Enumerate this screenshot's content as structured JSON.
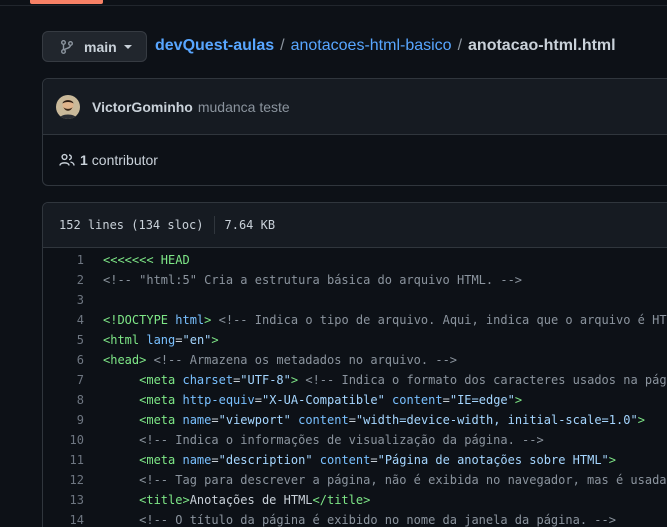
{
  "branch": {
    "label": "main"
  },
  "breadcrumb": {
    "repo": "devQuest-aulas",
    "folder": "anotacoes-html-basico",
    "file": "anotacao-html.html",
    "separator": "/"
  },
  "commit": {
    "author": "VictorGominho",
    "message": "mudanca teste",
    "contributors_count": "1",
    "contributors_label": "contributor"
  },
  "file_info": {
    "lines": "152 lines (134 sloc)",
    "size": "7.64 KB"
  },
  "colors": {
    "background": "#0d1117",
    "link": "#58a6ff",
    "tag": "#7ee787",
    "attribute": "#79c0ff",
    "string": "#a5d6ff",
    "comment": "#8b949e",
    "tab_accent": "#f78166"
  },
  "icons": {
    "branch": "git-branch-icon",
    "contributors": "people-icon",
    "caret": "caret-down-icon"
  },
  "code_lines": [
    {
      "num": "1",
      "tokens": [
        {
          "t": "<<<<<<< HEAD",
          "c": "git"
        }
      ]
    },
    {
      "num": "2",
      "tokens": [
        {
          "t": "<!-- \"html:5\" Cria a estrutura básica do arquivo HTML. -->",
          "c": "cm"
        }
      ]
    },
    {
      "num": "3",
      "tokens": []
    },
    {
      "num": "4",
      "tokens": [
        {
          "t": "<!DOCTYPE ",
          "c": "tag"
        },
        {
          "t": "html",
          "c": "attr"
        },
        {
          "t": ">",
          "c": "tag"
        },
        {
          "t": " ",
          "c": "pl"
        },
        {
          "t": "<!-- Indica o tipo de arquivo. Aqui, indica que o arquivo é HTML. -->",
          "c": "cm"
        }
      ]
    },
    {
      "num": "5",
      "tokens": [
        {
          "t": "<html ",
          "c": "tag"
        },
        {
          "t": "lang",
          "c": "attr"
        },
        {
          "t": "=",
          "c": "pl"
        },
        {
          "t": "\"en\"",
          "c": "str"
        },
        {
          "t": ">",
          "c": "tag"
        }
      ]
    },
    {
      "num": "6",
      "tokens": [
        {
          "t": "<head>",
          "c": "tag"
        },
        {
          "t": " ",
          "c": "pl"
        },
        {
          "t": "<!-- Armazena os metadados no arquivo. -->",
          "c": "cm"
        }
      ]
    },
    {
      "num": "7",
      "tokens": [
        {
          "t": "     ",
          "c": "pl"
        },
        {
          "t": "<meta ",
          "c": "tag"
        },
        {
          "t": "charset",
          "c": "attr"
        },
        {
          "t": "=",
          "c": "pl"
        },
        {
          "t": "\"UTF-8\"",
          "c": "str"
        },
        {
          "t": ">",
          "c": "tag"
        },
        {
          "t": " ",
          "c": "pl"
        },
        {
          "t": "<!-- Indica o formato dos caracteres usados na página. -->",
          "c": "cm"
        }
      ]
    },
    {
      "num": "8",
      "tokens": [
        {
          "t": "     ",
          "c": "pl"
        },
        {
          "t": "<meta ",
          "c": "tag"
        },
        {
          "t": "http-equiv",
          "c": "attr"
        },
        {
          "t": "=",
          "c": "pl"
        },
        {
          "t": "\"X-UA-Compatible\"",
          "c": "str"
        },
        {
          "t": " ",
          "c": "pl"
        },
        {
          "t": "content",
          "c": "attr"
        },
        {
          "t": "=",
          "c": "pl"
        },
        {
          "t": "\"IE=edge\"",
          "c": "str"
        },
        {
          "t": ">",
          "c": "tag"
        }
      ]
    },
    {
      "num": "9",
      "tokens": [
        {
          "t": "     ",
          "c": "pl"
        },
        {
          "t": "<meta ",
          "c": "tag"
        },
        {
          "t": "name",
          "c": "attr"
        },
        {
          "t": "=",
          "c": "pl"
        },
        {
          "t": "\"viewport\"",
          "c": "str"
        },
        {
          "t": " ",
          "c": "pl"
        },
        {
          "t": "content",
          "c": "attr"
        },
        {
          "t": "=",
          "c": "pl"
        },
        {
          "t": "\"width=device-width, initial-scale=1.0\"",
          "c": "str"
        },
        {
          "t": ">",
          "c": "tag"
        }
      ]
    },
    {
      "num": "10",
      "tokens": [
        {
          "t": "     ",
          "c": "pl"
        },
        {
          "t": "<!-- Indica o informações de visualização da página. -->",
          "c": "cm"
        }
      ]
    },
    {
      "num": "11",
      "tokens": [
        {
          "t": "     ",
          "c": "pl"
        },
        {
          "t": "<meta ",
          "c": "tag"
        },
        {
          "t": "name",
          "c": "attr"
        },
        {
          "t": "=",
          "c": "pl"
        },
        {
          "t": "\"description\"",
          "c": "str"
        },
        {
          "t": " ",
          "c": "pl"
        },
        {
          "t": "content",
          "c": "attr"
        },
        {
          "t": "=",
          "c": "pl"
        },
        {
          "t": "\"Página de anotações sobre HTML\"",
          "c": "str"
        },
        {
          "t": ">",
          "c": "tag"
        }
      ]
    },
    {
      "num": "12",
      "tokens": [
        {
          "t": "     ",
          "c": "pl"
        },
        {
          "t": "<!-- Tag para descrever a página, não é exibida no navegador, mas é usada por pág",
          "c": "cm"
        }
      ]
    },
    {
      "num": "13",
      "tokens": [
        {
          "t": "     ",
          "c": "pl"
        },
        {
          "t": "<title>",
          "c": "tag"
        },
        {
          "t": "Anotações de HTML",
          "c": "pl"
        },
        {
          "t": "</title>",
          "c": "tag"
        }
      ]
    },
    {
      "num": "14",
      "tokens": [
        {
          "t": "     ",
          "c": "pl"
        },
        {
          "t": "<!-- O título da página é exibido no nome da janela da página. -->",
          "c": "cm"
        }
      ]
    }
  ]
}
